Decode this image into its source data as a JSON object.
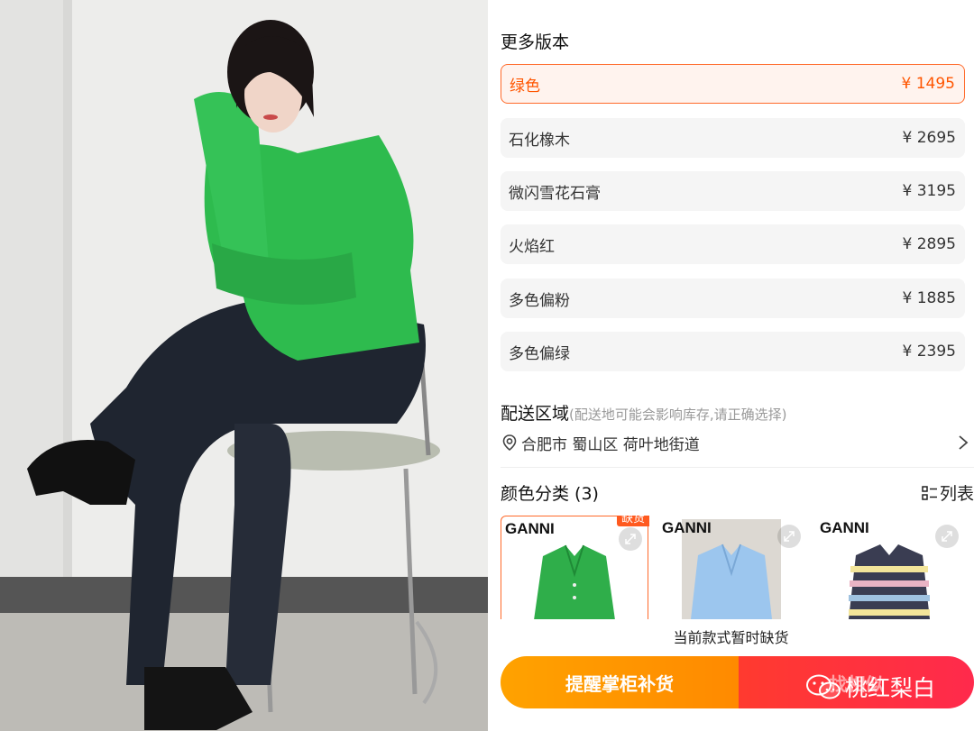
{
  "more_versions": {
    "title": "更多版本",
    "items": [
      {
        "name": "绿色",
        "price": "¥ 1495",
        "selected": true
      },
      {
        "name": "石化橡木",
        "price": "¥ 2695"
      },
      {
        "name": "微闪雪花石膏",
        "price": "¥ 3195"
      },
      {
        "name": "火焰红",
        "price": "¥ 2895"
      },
      {
        "name": "多色偏粉",
        "price": "¥ 1885"
      },
      {
        "name": "多色偏绿",
        "price": "¥ 2395"
      }
    ]
  },
  "delivery": {
    "title": "配送区域",
    "hint": "(配送地可能会影响库存,请正确选择)",
    "address": "合肥市 蜀山区 荷叶地街道"
  },
  "color_category": {
    "title": "颜色分类 (3)",
    "list_label": "列表",
    "cards": [
      {
        "brand": "GANNI",
        "tag": "缺货",
        "color": "#2fae4a",
        "bg": "#ffffff"
      },
      {
        "brand": "GANNI",
        "color": "#9cc6ee",
        "bg": "#dcd8d2"
      },
      {
        "brand": "GANNI",
        "color": "#3a3d52",
        "bg": "#ffffff"
      }
    ]
  },
  "notice": "当前款式暂时缺货",
  "buttons": {
    "remind": "提醒掌柜补货",
    "buy": "找相似"
  },
  "watermark": "桃红梨白",
  "colors": {
    "accent": "#ff6a2a",
    "orange_button": "#ff9500",
    "red_button": "#ff3040"
  }
}
